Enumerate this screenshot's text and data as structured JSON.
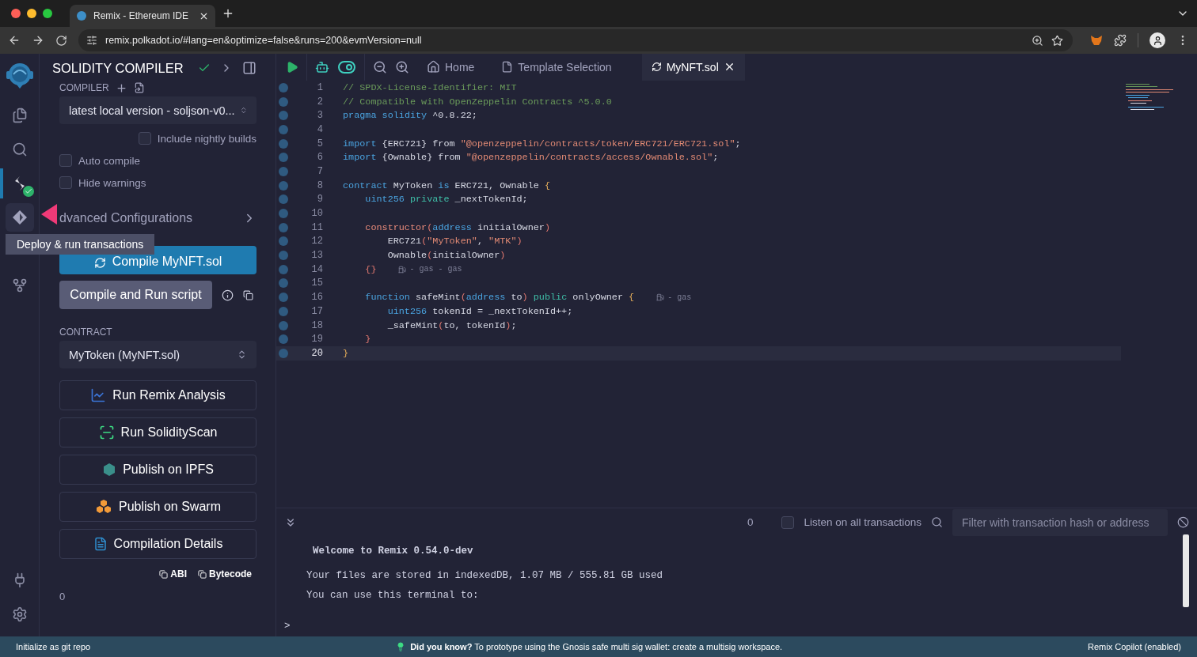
{
  "browser": {
    "tab_title": "Remix - Ethereum IDE",
    "url": "remix.polkadot.io/#lang=en&optimize=false&runs=200&evmVersion=null"
  },
  "icon_rail": [
    {
      "kind": "files",
      "selected": false,
      "hovered": false,
      "verified": false
    },
    {
      "kind": "search",
      "selected": false,
      "hovered": false,
      "verified": false
    },
    {
      "kind": "compiler",
      "selected": true,
      "hovered": false,
      "verified": true
    },
    {
      "kind": "deploy",
      "selected": false,
      "hovered": true,
      "verified": false
    },
    {
      "kind": "git",
      "selected": false,
      "hovered": false,
      "verified": false
    },
    {
      "kind": "plugin",
      "selected": false,
      "hovered": false,
      "verified": false
    },
    {
      "kind": "settings",
      "selected": false,
      "hovered": false,
      "verified": false
    }
  ],
  "tooltip": "Deploy & run transactions",
  "side_panel": {
    "title": "SOLIDITY COMPILER",
    "compiler_label": "COMPILER",
    "compiler_version": "latest local version - soljson-v0...",
    "nightly_builds": {
      "label": "Include nightly builds",
      "checked": false
    },
    "options": [
      {
        "label": "Auto compile",
        "checked": false
      },
      {
        "label": "Hide warnings",
        "checked": false
      }
    ],
    "advanced": "dvanced Configurations",
    "compile_button": "Compile MyNFT.sol",
    "run_script_button": "Compile and Run script",
    "contract_label": "CONTRACT",
    "contract": "MyToken (MyNFT.sol)",
    "actions": [
      {
        "kind": "analysis",
        "label": "Run Remix Analysis"
      },
      {
        "kind": "scan",
        "label": "Run SolidityScan"
      },
      {
        "kind": "ipfs",
        "label": "Publish on IPFS"
      },
      {
        "kind": "swarm",
        "label": "Publish on Swarm"
      },
      {
        "kind": "details",
        "label": "Compilation Details"
      }
    ],
    "copy_links": [
      "ABI",
      "Bytecode"
    ],
    "count": "0"
  },
  "editor": {
    "tabs": [
      {
        "kind": "home",
        "label": "Home",
        "selected": false
      },
      {
        "kind": "template",
        "label": "Template Selection",
        "selected": false
      },
      {
        "kind": "file",
        "label": "MyNFT.sol",
        "selected": true
      }
    ],
    "lines": [
      {
        "number": "1",
        "current": false,
        "code": [
          {
            "kind": "comment",
            "text": "// SPDX-License-Identifier: MIT"
          }
        ]
      },
      {
        "number": "2",
        "current": false,
        "code": [
          {
            "kind": "comment",
            "text": "// Compatible with OpenZeppelin Contracts ^5.0.0"
          }
        ]
      },
      {
        "number": "3",
        "current": false,
        "code": [
          {
            "kind": "keyword",
            "text": "pragma"
          },
          {
            "kind": "keyword",
            "text": " solidity"
          },
          {
            "kind": "plain",
            "text": " ^0.8.22;"
          }
        ]
      },
      {
        "number": "4",
        "current": false
      },
      {
        "number": "5",
        "current": false,
        "code": [
          {
            "kind": "keyword",
            "text": "import"
          },
          {
            "kind": "plain",
            "text": " {ERC721} from "
          },
          {
            "kind": "string",
            "text": "\"@openzeppelin/contracts/token/ERC721/ERC721.sol\""
          },
          {
            "kind": "plain",
            "text": ";"
          }
        ]
      },
      {
        "number": "6",
        "current": false,
        "code": [
          {
            "kind": "keyword",
            "text": "import"
          },
          {
            "kind": "plain",
            "text": " {Ownable} from "
          },
          {
            "kind": "string",
            "text": "\"@openzeppelin/contracts/access/Ownable.sol\""
          },
          {
            "kind": "plain",
            "text": ";"
          }
        ]
      },
      {
        "number": "7",
        "current": false
      },
      {
        "number": "8",
        "current": false,
        "code": [
          {
            "kind": "keyword",
            "text": "contract"
          },
          {
            "kind": "plain",
            "text": " MyToken "
          },
          {
            "kind": "keyword",
            "text": "is"
          },
          {
            "kind": "plain",
            "text": " ERC721, Ownable "
          },
          {
            "kind": "brace",
            "text": "{"
          }
        ]
      },
      {
        "number": "9",
        "current": false,
        "code": [
          {
            "kind": "keyword",
            "text": "    uint256"
          },
          {
            "kind": "modifier",
            "text": " private"
          },
          {
            "kind": "plain",
            "text": " _nextTokenId;"
          }
        ]
      },
      {
        "number": "10",
        "current": false
      },
      {
        "number": "11",
        "current": false,
        "code": [
          {
            "kind": "special",
            "text": "    constructor"
          },
          {
            "kind": "paren",
            "text": "("
          },
          {
            "kind": "keyword",
            "text": "address"
          },
          {
            "kind": "plain",
            "text": " initialOwner"
          },
          {
            "kind": "paren",
            "text": ")"
          }
        ]
      },
      {
        "number": "12",
        "current": false,
        "code": [
          {
            "kind": "plain",
            "text": "        ERC721"
          },
          {
            "kind": "paren",
            "text": "("
          },
          {
            "kind": "string",
            "text": "\"MyToken\""
          },
          {
            "kind": "plain",
            "text": ", "
          },
          {
            "kind": "string",
            "text": "\"MTK\""
          },
          {
            "kind": "paren",
            "text": ")"
          }
        ]
      },
      {
        "number": "13",
        "current": false,
        "code": [
          {
            "kind": "plain",
            "text": "        Ownable"
          },
          {
            "kind": "paren",
            "text": "("
          },
          {
            "kind": "plain",
            "text": "initialOwner"
          },
          {
            "kind": "paren",
            "text": ")"
          }
        ]
      },
      {
        "number": "14",
        "current": false,
        "code": [
          {
            "kind": "paren",
            "text": "    {}"
          }
        ],
        "hint": "- gas - gas"
      },
      {
        "number": "15",
        "current": false
      },
      {
        "number": "16",
        "current": false,
        "code": [
          {
            "kind": "keyword",
            "text": "    function"
          },
          {
            "kind": "plain",
            "text": " safeMint"
          },
          {
            "kind": "paren",
            "text": "("
          },
          {
            "kind": "keyword",
            "text": "address"
          },
          {
            "kind": "plain",
            "text": " to"
          },
          {
            "kind": "paren",
            "text": ")"
          },
          {
            "kind": "modifier",
            "text": " public"
          },
          {
            "kind": "plain",
            "text": " onlyOwner "
          },
          {
            "kind": "brace",
            "text": "{"
          }
        ],
        "hint": "- gas"
      },
      {
        "number": "17",
        "current": false,
        "code": [
          {
            "kind": "keyword",
            "text": "        uint256"
          },
          {
            "kind": "plain",
            "text": " tokenId = _nextTokenId++;"
          }
        ]
      },
      {
        "number": "18",
        "current": false,
        "code": [
          {
            "kind": "plain",
            "text": "        _safeMint"
          },
          {
            "kind": "paren",
            "text": "("
          },
          {
            "kind": "plain",
            "text": "to, tokenId"
          },
          {
            "kind": "paren",
            "text": ")"
          },
          {
            "kind": "plain",
            "text": ";"
          }
        ]
      },
      {
        "number": "19",
        "current": false,
        "code": [
          {
            "kind": "paren",
            "text": "    }"
          }
        ]
      },
      {
        "number": "20",
        "current": true,
        "code": [
          {
            "kind": "brace",
            "text": "}"
          }
        ]
      }
    ]
  },
  "terminal": {
    "count": "0",
    "listen": {
      "label": "Listen on all transactions",
      "checked": false
    },
    "filter_placeholder": "Filter with transaction hash or address",
    "messages": [
      {
        "kind": "heading",
        "text": "Welcome to Remix 0.54.0-dev"
      },
      {
        "kind": "text",
        "text": "Your files are stored in indexedDB, 1.07 MB / 555.81 GB used"
      },
      {
        "kind": "text",
        "text": "You can use this terminal to:"
      }
    ],
    "prompt": ">"
  },
  "status_bar": {
    "left": "Initialize as git repo",
    "tip": "**Did you know?** To prototype using the Gnosis safe multi sig wallet: create a multisig workspace.",
    "right": "Remix Copilot (enabled)"
  }
}
